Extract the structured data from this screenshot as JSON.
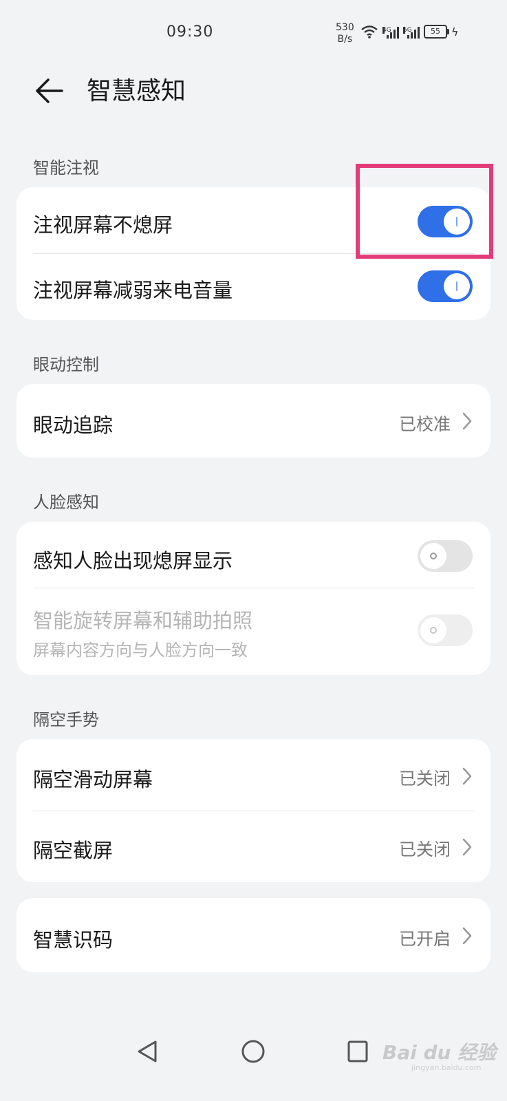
{
  "status_bar": {
    "time": "09:30",
    "net_speed_value": "530",
    "net_speed_unit": "B/s",
    "signal1_tag": "4G",
    "signal2_tag": "5G",
    "battery": "55",
    "icons": [
      "wifi-icon",
      "signal-icon",
      "signal-icon",
      "battery-icon",
      "charging-icon"
    ]
  },
  "header": {
    "title": "智慧感知",
    "back_icon": "back-arrow-icon"
  },
  "sections": {
    "smart_gaze": {
      "label": "智能注视",
      "items": [
        {
          "label": "注视屏幕不熄屏",
          "toggle": true
        },
        {
          "label": "注视屏幕减弱来电音量",
          "toggle": true
        }
      ]
    },
    "eye_control": {
      "label": "眼动控制",
      "items": [
        {
          "label": "眼动追踪",
          "value": "已校准"
        }
      ]
    },
    "face_perception": {
      "label": "人脸感知",
      "items": [
        {
          "label": "感知人脸出现熄屏显示",
          "toggle": false
        },
        {
          "label": "智能旋转屏幕和辅助拍照",
          "subtitle": "屏幕内容方向与人脸方向一致",
          "toggle": false,
          "disabled": true
        }
      ]
    },
    "air_gesture": {
      "label": "隔空手势",
      "items": [
        {
          "label": "隔空滑动屏幕",
          "value": "已关闭"
        },
        {
          "label": "隔空截屏",
          "value": "已关闭"
        }
      ]
    },
    "smart_code": {
      "items": [
        {
          "label": "智慧识码",
          "value": "已开启"
        }
      ]
    }
  },
  "highlight_color": "#e23d7a",
  "accent_color": "#2f6fe8",
  "watermark": {
    "text": "Bai du 经验",
    "sub": "jingyan.baidu.com"
  },
  "nav": [
    "back-triangle-icon",
    "home-circle-icon",
    "recents-square-icon"
  ]
}
